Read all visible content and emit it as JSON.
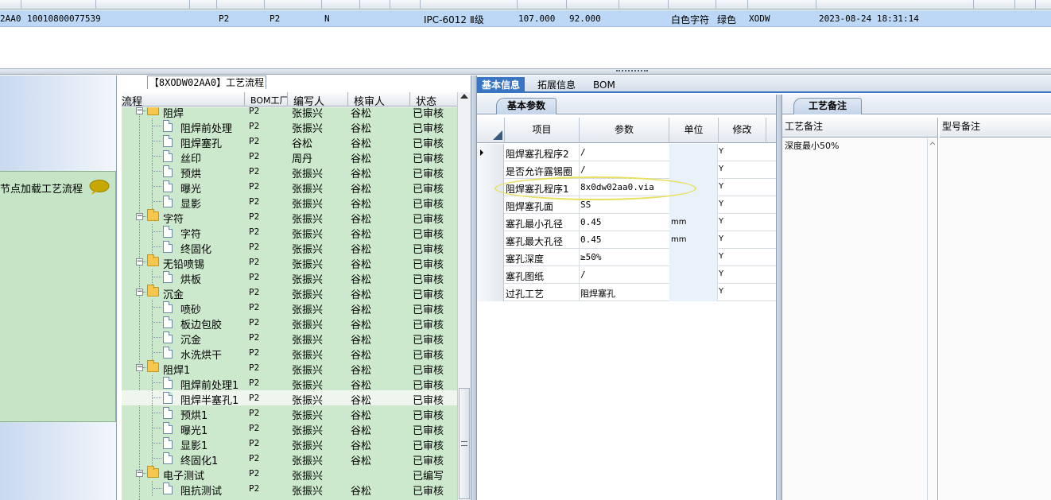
{
  "top_grid": {
    "row": {
      "code_tail": "2AA0",
      "number": "10010800077539",
      "factory": "P2",
      "factory2": "P2",
      "flag": "N",
      "grade": "IPC-6012 Ⅱ级",
      "length": "107.000",
      "width": "92.000",
      "char_color": "白色字符",
      "mask_color": "绿色",
      "user": "XODW",
      "timestamp": "2023-08-24 18:31:14"
    }
  },
  "left_panel": {
    "node_label": "节点加载工艺流程"
  },
  "tree": {
    "title": "【8XODW02AA0】工艺流程",
    "headers": {
      "flow": "流程",
      "bom": "BOM工厂",
      "writer": "编写人",
      "reviewer": "核审人",
      "status": "状态"
    },
    "rows": [
      {
        "kind": "folder",
        "level": 1,
        "label": "阻焊",
        "bom": "P2",
        "writer": "张振兴",
        "reviewer": "谷松",
        "status": "已审核"
      },
      {
        "kind": "doc",
        "level": 2,
        "label": "阻焊前处理",
        "bom": "P2",
        "writer": "张振兴",
        "reviewer": "谷松",
        "status": "已审核"
      },
      {
        "kind": "doc",
        "level": 2,
        "label": "阻焊塞孔",
        "bom": "P2",
        "writer": "谷松",
        "reviewer": "谷松",
        "status": "已审核"
      },
      {
        "kind": "doc",
        "level": 2,
        "label": "丝印",
        "bom": "P2",
        "writer": "周丹",
        "reviewer": "谷松",
        "status": "已审核"
      },
      {
        "kind": "doc",
        "level": 2,
        "label": "预烘",
        "bom": "P2",
        "writer": "张振兴",
        "reviewer": "谷松",
        "status": "已审核"
      },
      {
        "kind": "doc",
        "level": 2,
        "label": "曝光",
        "bom": "P2",
        "writer": "张振兴",
        "reviewer": "谷松",
        "status": "已审核"
      },
      {
        "kind": "doc",
        "level": 2,
        "label": "显影",
        "bom": "P2",
        "writer": "张振兴",
        "reviewer": "谷松",
        "status": "已审核"
      },
      {
        "kind": "folder",
        "level": 1,
        "label": "字符",
        "bom": "P2",
        "writer": "张振兴",
        "reviewer": "谷松",
        "status": "已审核"
      },
      {
        "kind": "doc",
        "level": 2,
        "label": "字符",
        "bom": "P2",
        "writer": "张振兴",
        "reviewer": "谷松",
        "status": "已审核"
      },
      {
        "kind": "doc",
        "level": 2,
        "label": "终固化",
        "bom": "P2",
        "writer": "张振兴",
        "reviewer": "谷松",
        "status": "已审核"
      },
      {
        "kind": "folder",
        "level": 1,
        "label": "无铅喷锡",
        "bom": "P2",
        "writer": "张振兴",
        "reviewer": "谷松",
        "status": "已审核"
      },
      {
        "kind": "doc",
        "level": 2,
        "label": "烘板",
        "bom": "P2",
        "writer": "张振兴",
        "reviewer": "谷松",
        "status": "已审核"
      },
      {
        "kind": "folder",
        "level": 1,
        "label": "沉金",
        "bom": "P2",
        "writer": "张振兴",
        "reviewer": "谷松",
        "status": "已审核"
      },
      {
        "kind": "doc",
        "level": 2,
        "label": "喷砂",
        "bom": "P2",
        "writer": "张振兴",
        "reviewer": "谷松",
        "status": "已审核"
      },
      {
        "kind": "doc",
        "level": 2,
        "label": "板边包胶",
        "bom": "P2",
        "writer": "张振兴",
        "reviewer": "谷松",
        "status": "已审核"
      },
      {
        "kind": "doc",
        "level": 2,
        "label": "沉金",
        "bom": "P2",
        "writer": "张振兴",
        "reviewer": "谷松",
        "status": "已审核"
      },
      {
        "kind": "doc",
        "level": 2,
        "label": "水洗烘干",
        "bom": "P2",
        "writer": "张振兴",
        "reviewer": "谷松",
        "status": "已审核"
      },
      {
        "kind": "folder",
        "level": 1,
        "label": "阻焊1",
        "bom": "P2",
        "writer": "张振兴",
        "reviewer": "谷松",
        "status": "已审核"
      },
      {
        "kind": "doc",
        "level": 2,
        "label": "阻焊前处理1",
        "bom": "P2",
        "writer": "张振兴",
        "reviewer": "谷松",
        "status": "已审核"
      },
      {
        "kind": "doc",
        "level": 2,
        "label": "阻焊半塞孔1",
        "bom": "P2",
        "writer": "张振兴",
        "reviewer": "谷松",
        "status": "已审核",
        "selected": true
      },
      {
        "kind": "doc",
        "level": 2,
        "label": "预烘1",
        "bom": "P2",
        "writer": "张振兴",
        "reviewer": "谷松",
        "status": "已审核"
      },
      {
        "kind": "doc",
        "level": 2,
        "label": "曝光1",
        "bom": "P2",
        "writer": "张振兴",
        "reviewer": "谷松",
        "status": "已审核"
      },
      {
        "kind": "doc",
        "level": 2,
        "label": "显影1",
        "bom": "P2",
        "writer": "张振兴",
        "reviewer": "谷松",
        "status": "已审核"
      },
      {
        "kind": "doc",
        "level": 2,
        "label": "终固化1",
        "bom": "P2",
        "writer": "张振兴",
        "reviewer": "谷松",
        "status": "已审核"
      },
      {
        "kind": "folder",
        "level": 1,
        "label": "电子测试",
        "bom": "P2",
        "writer": "张振兴",
        "reviewer": "",
        "status": "已编写"
      },
      {
        "kind": "doc",
        "level": 2,
        "label": "阻抗测试",
        "bom": "P2",
        "writer": "张振兴",
        "reviewer": "谷松",
        "status": "已审核"
      }
    ]
  },
  "right_tabs": [
    "基本信息",
    "拓展信息",
    "BOM"
  ],
  "params": {
    "tab_label": "基本参数",
    "headers": {
      "item": "项目",
      "param": "参数",
      "unit": "单位",
      "modify": "修改"
    },
    "rows": [
      {
        "item": "阻焊塞孔程序2",
        "param": "/",
        "unit": "",
        "modify": "Y",
        "current": true
      },
      {
        "item": "是否允许露锡圈",
        "param": "/",
        "unit": "",
        "modify": "Y"
      },
      {
        "item": "阻焊塞孔程序1",
        "param": "8x0dw02aa0.via",
        "unit": "",
        "modify": "Y"
      },
      {
        "item": "阻焊塞孔面",
        "param": "SS",
        "unit": "",
        "modify": "Y"
      },
      {
        "item": "塞孔最小孔径",
        "param": "0.45",
        "unit": "mm",
        "modify": "Y"
      },
      {
        "item": "塞孔最大孔径",
        "param": "0.45",
        "unit": "mm",
        "modify": "Y"
      },
      {
        "item": "塞孔深度",
        "param": "≥50%",
        "unit": "",
        "modify": "Y"
      },
      {
        "item": "塞孔图纸",
        "param": "/",
        "unit": "",
        "modify": "Y"
      },
      {
        "item": "过孔工艺",
        "param": "阻焊塞孔",
        "unit": "",
        "modify": "Y"
      }
    ]
  },
  "notes": {
    "tab_label": "工艺备注",
    "col1_header": "工艺备注",
    "col2_header": "型号备注",
    "process_note": "深度最小50%"
  }
}
